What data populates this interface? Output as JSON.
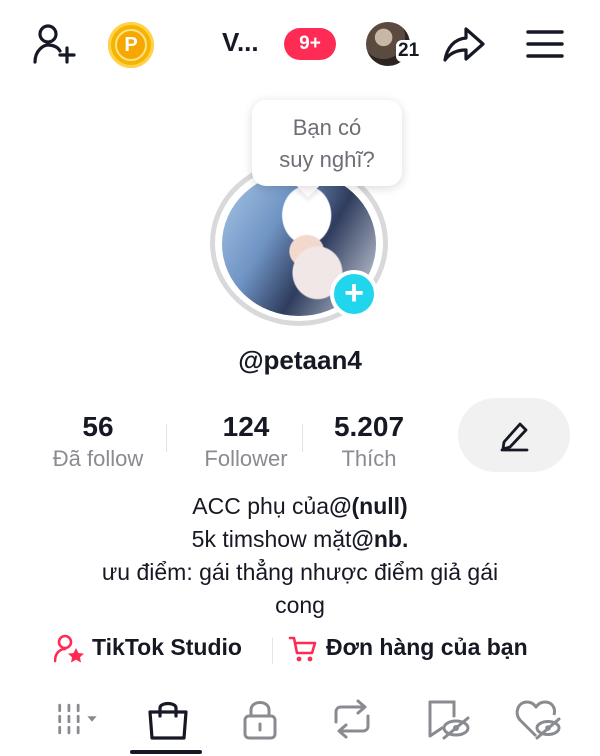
{
  "header": {
    "title": "V...",
    "notification_badge": "9+",
    "story_count": "21",
    "coin_letter": "P",
    "icons": [
      "add-friend-icon",
      "coin-icon",
      "share-icon",
      "menu-icon"
    ]
  },
  "tooltip": {
    "line1": "Bạn có",
    "line2": "suy nghĩ?"
  },
  "profile": {
    "username": "@petaan4",
    "stats": [
      {
        "value": "56",
        "label": "Đã follow"
      },
      {
        "value": "124",
        "label": "Follower"
      },
      {
        "value": "5.207",
        "label": "Thích"
      }
    ],
    "bio": {
      "line1_text": "ACC phụ của",
      "line1_mention": "@(null)",
      "line2_text": "5k timshow mặt",
      "line2_mention": "@nb.",
      "line3": "ưu điểm: gái thẳng nhược điểm giả gái",
      "line4": "cong"
    }
  },
  "links": {
    "studio": "TikTok Studio",
    "orders": "Đơn hàng của bạn"
  },
  "colors": {
    "accent": "#fe2c55",
    "add_button": "#20d5ec",
    "coin": "#f4b400"
  },
  "tabs": [
    "videos-grid-icon",
    "shop-bag-icon",
    "lock-icon",
    "repost-icon",
    "favorites-icon",
    "liked-icon"
  ]
}
